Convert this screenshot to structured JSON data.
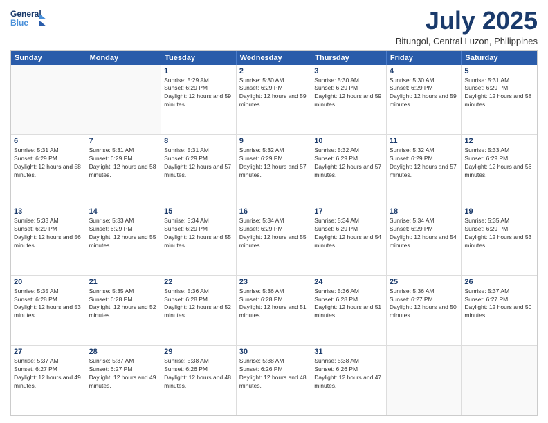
{
  "header": {
    "logo_line1": "General",
    "logo_line2": "Blue",
    "title": "July 2025",
    "subtitle": "Bitungol, Central Luzon, Philippines"
  },
  "days_of_week": [
    "Sunday",
    "Monday",
    "Tuesday",
    "Wednesday",
    "Thursday",
    "Friday",
    "Saturday"
  ],
  "weeks": [
    [
      {
        "day": "",
        "empty": true
      },
      {
        "day": "",
        "empty": true
      },
      {
        "day": "1",
        "sunrise": "5:29 AM",
        "sunset": "6:29 PM",
        "daylight": "12 hours and 59 minutes."
      },
      {
        "day": "2",
        "sunrise": "5:30 AM",
        "sunset": "6:29 PM",
        "daylight": "12 hours and 59 minutes."
      },
      {
        "day": "3",
        "sunrise": "5:30 AM",
        "sunset": "6:29 PM",
        "daylight": "12 hours and 59 minutes."
      },
      {
        "day": "4",
        "sunrise": "5:30 AM",
        "sunset": "6:29 PM",
        "daylight": "12 hours and 59 minutes."
      },
      {
        "day": "5",
        "sunrise": "5:31 AM",
        "sunset": "6:29 PM",
        "daylight": "12 hours and 58 minutes."
      }
    ],
    [
      {
        "day": "6",
        "sunrise": "5:31 AM",
        "sunset": "6:29 PM",
        "daylight": "12 hours and 58 minutes."
      },
      {
        "day": "7",
        "sunrise": "5:31 AM",
        "sunset": "6:29 PM",
        "daylight": "12 hours and 58 minutes."
      },
      {
        "day": "8",
        "sunrise": "5:31 AM",
        "sunset": "6:29 PM",
        "daylight": "12 hours and 57 minutes."
      },
      {
        "day": "9",
        "sunrise": "5:32 AM",
        "sunset": "6:29 PM",
        "daylight": "12 hours and 57 minutes."
      },
      {
        "day": "10",
        "sunrise": "5:32 AM",
        "sunset": "6:29 PM",
        "daylight": "12 hours and 57 minutes."
      },
      {
        "day": "11",
        "sunrise": "5:32 AM",
        "sunset": "6:29 PM",
        "daylight": "12 hours and 57 minutes."
      },
      {
        "day": "12",
        "sunrise": "5:33 AM",
        "sunset": "6:29 PM",
        "daylight": "12 hours and 56 minutes."
      }
    ],
    [
      {
        "day": "13",
        "sunrise": "5:33 AM",
        "sunset": "6:29 PM",
        "daylight": "12 hours and 56 minutes."
      },
      {
        "day": "14",
        "sunrise": "5:33 AM",
        "sunset": "6:29 PM",
        "daylight": "12 hours and 55 minutes."
      },
      {
        "day": "15",
        "sunrise": "5:34 AM",
        "sunset": "6:29 PM",
        "daylight": "12 hours and 55 minutes."
      },
      {
        "day": "16",
        "sunrise": "5:34 AM",
        "sunset": "6:29 PM",
        "daylight": "12 hours and 55 minutes."
      },
      {
        "day": "17",
        "sunrise": "5:34 AM",
        "sunset": "6:29 PM",
        "daylight": "12 hours and 54 minutes."
      },
      {
        "day": "18",
        "sunrise": "5:34 AM",
        "sunset": "6:29 PM",
        "daylight": "12 hours and 54 minutes."
      },
      {
        "day": "19",
        "sunrise": "5:35 AM",
        "sunset": "6:29 PM",
        "daylight": "12 hours and 53 minutes."
      }
    ],
    [
      {
        "day": "20",
        "sunrise": "5:35 AM",
        "sunset": "6:28 PM",
        "daylight": "12 hours and 53 minutes."
      },
      {
        "day": "21",
        "sunrise": "5:35 AM",
        "sunset": "6:28 PM",
        "daylight": "12 hours and 52 minutes."
      },
      {
        "day": "22",
        "sunrise": "5:36 AM",
        "sunset": "6:28 PM",
        "daylight": "12 hours and 52 minutes."
      },
      {
        "day": "23",
        "sunrise": "5:36 AM",
        "sunset": "6:28 PM",
        "daylight": "12 hours and 51 minutes."
      },
      {
        "day": "24",
        "sunrise": "5:36 AM",
        "sunset": "6:28 PM",
        "daylight": "12 hours and 51 minutes."
      },
      {
        "day": "25",
        "sunrise": "5:36 AM",
        "sunset": "6:27 PM",
        "daylight": "12 hours and 50 minutes."
      },
      {
        "day": "26",
        "sunrise": "5:37 AM",
        "sunset": "6:27 PM",
        "daylight": "12 hours and 50 minutes."
      }
    ],
    [
      {
        "day": "27",
        "sunrise": "5:37 AM",
        "sunset": "6:27 PM",
        "daylight": "12 hours and 49 minutes."
      },
      {
        "day": "28",
        "sunrise": "5:37 AM",
        "sunset": "6:27 PM",
        "daylight": "12 hours and 49 minutes."
      },
      {
        "day": "29",
        "sunrise": "5:38 AM",
        "sunset": "6:26 PM",
        "daylight": "12 hours and 48 minutes."
      },
      {
        "day": "30",
        "sunrise": "5:38 AM",
        "sunset": "6:26 PM",
        "daylight": "12 hours and 48 minutes."
      },
      {
        "day": "31",
        "sunrise": "5:38 AM",
        "sunset": "6:26 PM",
        "daylight": "12 hours and 47 minutes."
      },
      {
        "day": "",
        "empty": true
      },
      {
        "day": "",
        "empty": true
      }
    ]
  ]
}
